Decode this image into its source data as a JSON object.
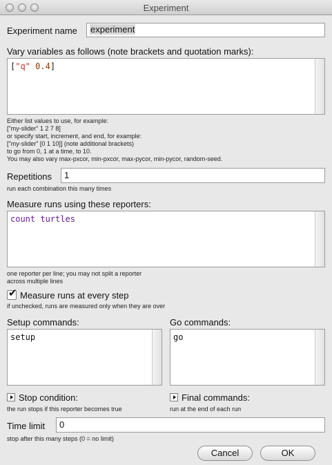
{
  "window": {
    "title": "Experiment"
  },
  "experiment_name": {
    "label": "Experiment name",
    "value": "experiment"
  },
  "vary": {
    "label": "Vary variables as follows (note brackets and quotation marks):",
    "code": {
      "open": "[",
      "str": "\"q\"",
      "num": "0.4",
      "close": "]"
    },
    "help": [
      "Either list values to use, for example:",
      "[\"my-slider\" 1 2 7 8]",
      "or specify start, increment, and end, for example:",
      "[\"my-slider\" [0 1 10]] (note additional brackets)",
      "to go from 0, 1 at a time, to 10.",
      "You may also vary max-pxcor, min-pxcor, max-pycor, min-pycor, random-seed."
    ]
  },
  "repetitions": {
    "label": "Repetitions",
    "value": "1",
    "help": "run each combination this many times"
  },
  "measure": {
    "label": "Measure runs using these reporters:",
    "value": "count turtles",
    "help": [
      "one reporter per line; you may not split a reporter",
      "across multiple lines"
    ]
  },
  "every_step": {
    "label": "Measure runs at every step",
    "help": "if unchecked, runs are measured only when they are over",
    "checked": true
  },
  "setup": {
    "label": "Setup commands:",
    "value": "setup"
  },
  "go": {
    "label": "Go commands:",
    "value": "go"
  },
  "stop": {
    "label": "Stop condition:",
    "help": "the run stops if this reporter becomes true"
  },
  "final": {
    "label": "Final commands:",
    "help": "run at the end of each run"
  },
  "time_limit": {
    "label": "Time limit",
    "value": "0",
    "help": "stop after this many steps (0 = no limit)"
  },
  "buttons": {
    "cancel": "Cancel",
    "ok": "OK"
  }
}
